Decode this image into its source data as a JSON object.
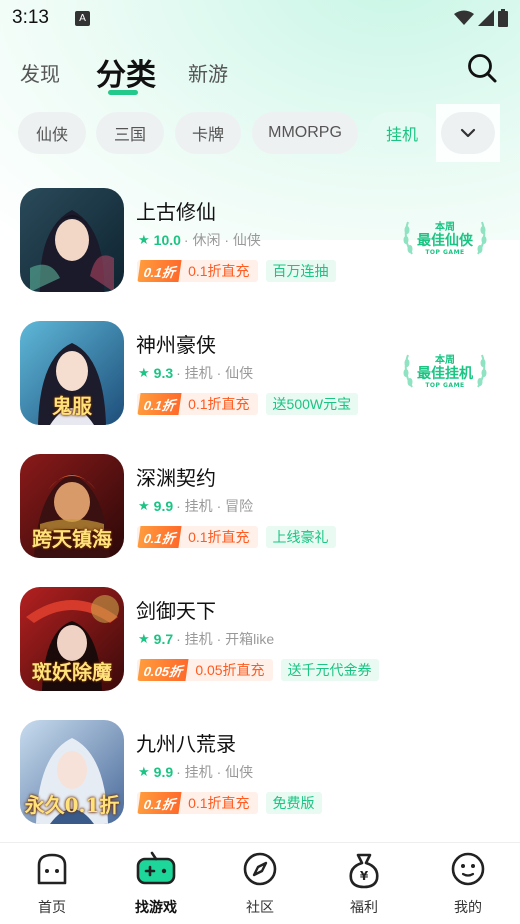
{
  "status_bar": {
    "time": "3:13",
    "notification_icon": "A"
  },
  "header": {
    "tabs": [
      {
        "label": "发现"
      },
      {
        "label": "分类"
      },
      {
        "label": "新游"
      }
    ],
    "active_tab": "分类",
    "accent_color": "#22c98a"
  },
  "categories": {
    "chips": [
      "仙侠",
      "三国",
      "卡牌",
      "MMORPG",
      "挂机"
    ],
    "selected": "挂机"
  },
  "games": [
    {
      "name": "上古修仙",
      "score": "10.0",
      "genres": "· 休闲 · 仙侠",
      "discount_badge": "0.1折",
      "discount_text": "0.1折直充",
      "promo": "百万连抽",
      "award": {
        "top": "本周",
        "title": "最佳仙侠",
        "sub": "TOP GAME"
      },
      "icon_caption": ""
    },
    {
      "name": "神州豪侠",
      "score": "9.3",
      "genres": "· 挂机 · 仙侠",
      "discount_badge": "0.1折",
      "discount_text": "0.1折直充",
      "promo": "送500W元宝",
      "award": {
        "top": "本周",
        "title": "最佳挂机",
        "sub": "TOP GAME"
      },
      "icon_caption": "鬼服"
    },
    {
      "name": "深渊契约",
      "score": "9.9",
      "genres": "· 挂机 · 冒险",
      "discount_badge": "0.1折",
      "discount_text": "0.1折直充",
      "promo": "上线豪礼",
      "icon_caption": "跨天镇海"
    },
    {
      "name": "剑御天下",
      "score": "9.7",
      "genres": "· 挂机 · 开箱like",
      "discount_badge": "0.05折",
      "discount_text": "0.05折直充",
      "promo": "送千元代金券",
      "icon_caption": "斑妖除魔"
    },
    {
      "name": "九州八荒录",
      "score": "9.9",
      "genres": "· 挂机 · 仙侠",
      "discount_badge": "0.1折",
      "discount_text": "0.1折直充",
      "promo": "免费版",
      "icon_caption": "永久0.1折"
    }
  ],
  "bottom_nav": [
    {
      "label": "首页",
      "icon": "home-icon"
    },
    {
      "label": "找游戏",
      "icon": "gamepad-icon"
    },
    {
      "label": "社区",
      "icon": "compass-icon"
    },
    {
      "label": "福利",
      "icon": "money-bag-icon"
    },
    {
      "label": "我的",
      "icon": "profile-face-icon"
    }
  ],
  "active_nav": "找游戏"
}
